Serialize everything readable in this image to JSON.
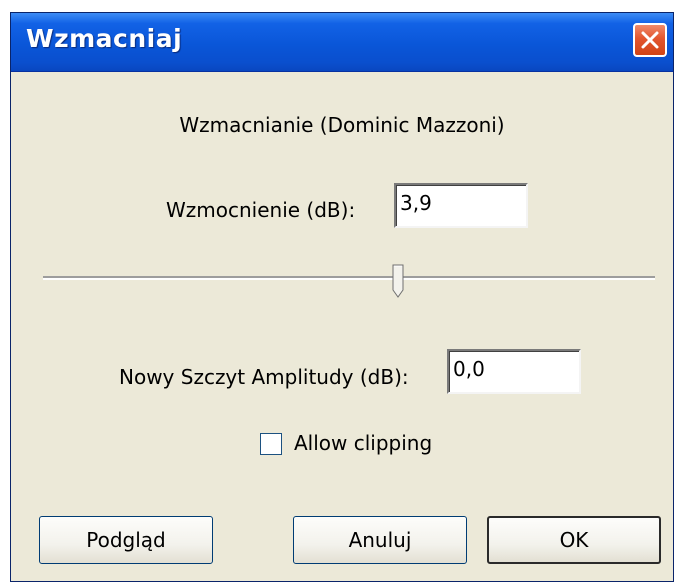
{
  "window": {
    "title": "Wzmacniaj"
  },
  "effect": {
    "heading": "Wzmacnianie (Dominic Mazzoni)"
  },
  "amplification": {
    "label": "Wzmocnienie (dB):",
    "value": "3,9",
    "slider_fraction": 0.58
  },
  "peak": {
    "label": "Nowy Szczyt Amplitudy (dB):",
    "value": "0,0"
  },
  "clipping": {
    "label": "Allow clipping",
    "checked": false
  },
  "buttons": {
    "preview": "Podgląd",
    "cancel": "Anuluj",
    "ok": "OK"
  },
  "icons": {
    "close": "close-icon"
  }
}
